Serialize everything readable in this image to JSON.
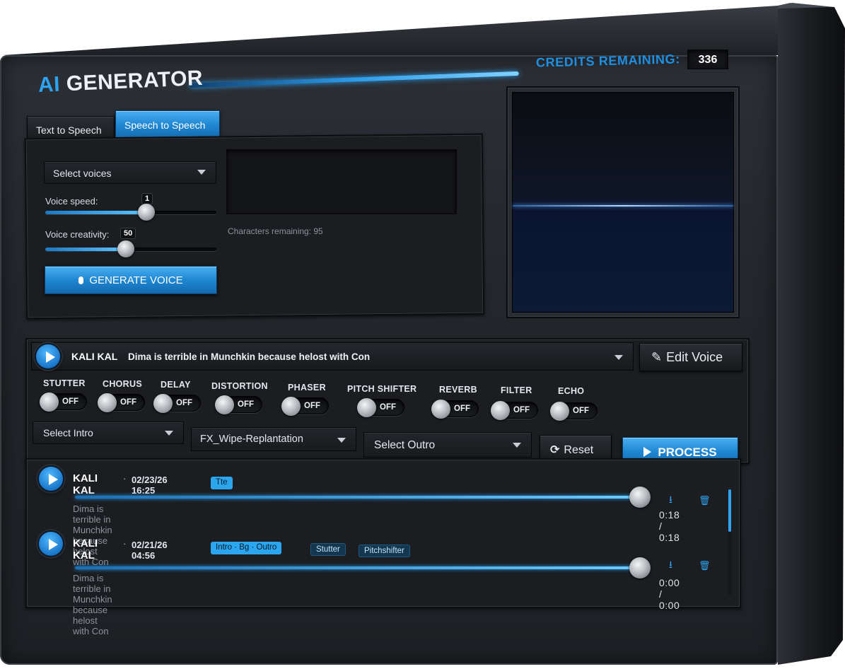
{
  "app": {
    "title_prefix": "AI",
    "title": "GENERATOR",
    "credits_label": "CREDITS REMAINING:",
    "credits_value": "336"
  },
  "tabs": [
    {
      "label": "Text to Speech",
      "active": false
    },
    {
      "label": "Speech to Speech",
      "active": true
    }
  ],
  "controls": {
    "voice_select": "Select voices",
    "voice_speed_label": "Voice speed:",
    "voice_speed_value": "1",
    "voice_speed_level": 0.59,
    "voice_creativity_label": "Voice creativity:",
    "voice_creativity_value": "50",
    "voice_creativity_level": 0.47,
    "generate_label": "GENERATE VOICE",
    "text_value": "",
    "chars_remaining": "Characters remaining: 95"
  },
  "current": {
    "voice": "KALI KAL",
    "text": "Dima is terrible in Munchkin because helost with Con",
    "edit_label": "Edit Voice"
  },
  "effects": [
    {
      "label": "STUTTER",
      "state": "OFF"
    },
    {
      "label": "CHORUS",
      "state": "OFF"
    },
    {
      "label": "DELAY",
      "state": "OFF"
    },
    {
      "label": "DISTORTION",
      "state": "OFF"
    },
    {
      "label": "PHASER",
      "state": "OFF"
    },
    {
      "label": "PITCH SHIFTER",
      "state": "OFF"
    },
    {
      "label": "REVERB",
      "state": "OFF"
    },
    {
      "label": "FILTER",
      "state": "OFF"
    },
    {
      "label": "ECHO",
      "state": "OFF"
    }
  ],
  "sequence": {
    "intro": "Select Intro",
    "middle": "FX_Wipe-Replantation",
    "outro": "Select Outro",
    "reset_label": "Reset",
    "process_label": "PROCESS"
  },
  "history": [
    {
      "voice": "KALI KAL",
      "separator": "·",
      "date": "02/23/26 16:25",
      "tags": [
        {
          "text": "Tte",
          "style": "blue"
        }
      ],
      "text": "Dima is terrible in Munchkin because helost with Con",
      "time": "0:18 / 0:18",
      "progress": 1.0
    },
    {
      "voice": "KALI KAL",
      "separator": "·",
      "date": "02/21/26 04:56",
      "tags": [
        {
          "text": "Intro · Bg · Outro",
          "style": "blue"
        },
        {
          "text": "Stutter",
          "style": "dark"
        },
        {
          "text": "Pitchshifter",
          "style": "dark"
        }
      ],
      "text": "Dima is terrible in Munchkin because helost with Con",
      "time": "0:00 / 0:00",
      "progress": 1.0
    }
  ],
  "colors": {
    "accent": "#2ea3ef",
    "credits": "#1f8fe0",
    "panel": "#1b1d21"
  }
}
